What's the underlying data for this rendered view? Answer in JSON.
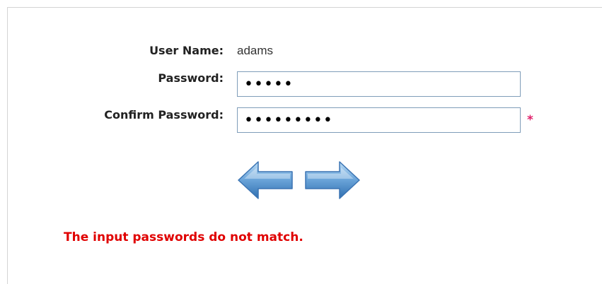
{
  "form": {
    "username_label": "User Name:",
    "username_value": "adams",
    "password_label": "Password:",
    "password_value": "•••••",
    "confirm_label": "Confirm Password:",
    "confirm_value": "•••••••••",
    "required_marker": "*"
  },
  "navigation": {
    "back_icon": "arrow-left-icon",
    "next_icon": "arrow-right-icon"
  },
  "message": {
    "error_text": "The input passwords do not match.",
    "error_color": "#e00000"
  },
  "colors": {
    "arrow_fill": "#5b9bd5",
    "required_marker": "#e0206a"
  }
}
